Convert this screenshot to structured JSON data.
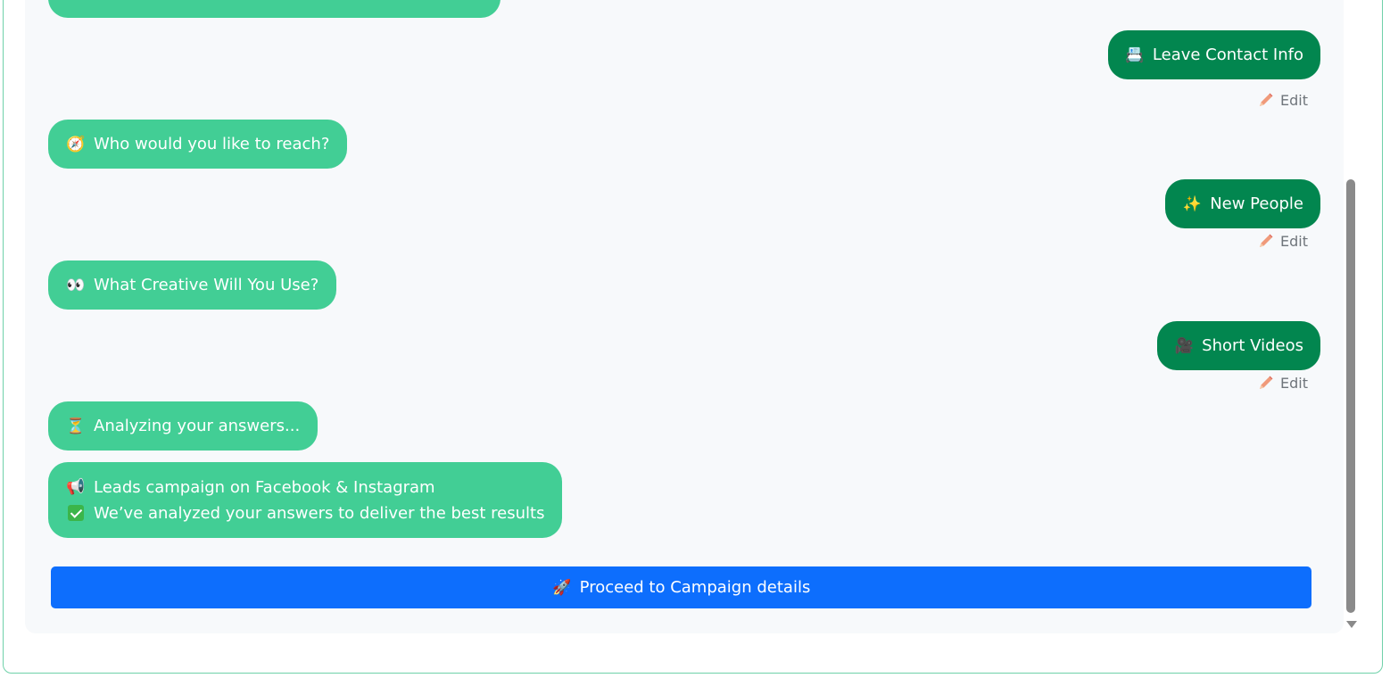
{
  "messages": {
    "contact_reply": {
      "emoji": "📇",
      "text": "Leave Contact Info"
    },
    "reach_question": {
      "emoji": "🧭",
      "text": "Who would you like to reach?"
    },
    "reach_reply": {
      "emoji": "✨",
      "text": "New People"
    },
    "creative_question": {
      "emoji": "👀",
      "text": "What Creative Will You Use?"
    },
    "creative_reply": {
      "emoji": "🎥",
      "text": "Short Videos"
    },
    "analyzing": {
      "emoji": "⏳",
      "text": "Analyzing your answers..."
    },
    "result": {
      "line1_emoji": "📢",
      "line1": "Leads campaign on Facebook & Instagram",
      "line2": "We’ve analyzed your answers to deliver the best results"
    }
  },
  "edit_label": "Edit",
  "proceed": {
    "emoji": "🚀",
    "label": "Proceed to Campaign details"
  },
  "colors": {
    "bot_bubble": "#42ce95",
    "user_bubble": "#02864f",
    "primary_button": "#0d6efd",
    "panel_bg": "#f7f9fb"
  }
}
